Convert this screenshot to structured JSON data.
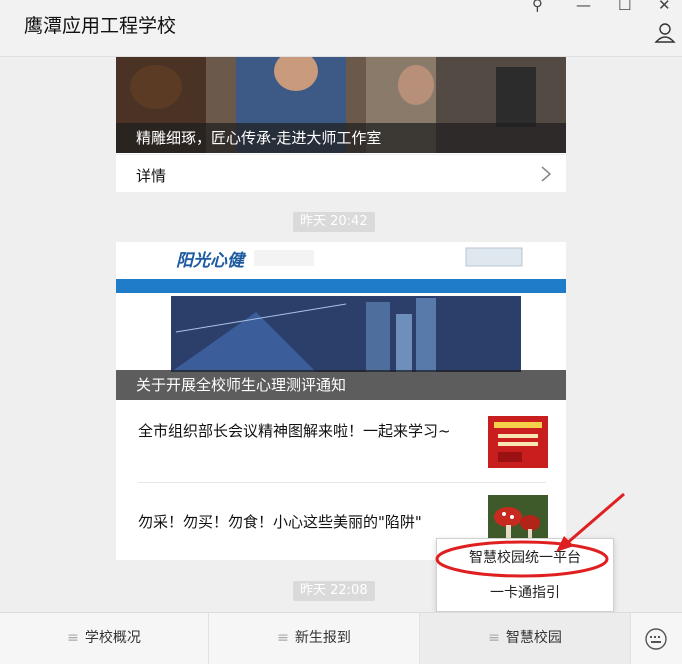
{
  "window": {
    "title": "鹰潭应用工程学校",
    "pin_glyph": "⚲",
    "min_glyph": "—",
    "max_glyph": "☐",
    "close_glyph": "✕"
  },
  "card1": {
    "caption": "精雕细琢，匠心传承-走进大师工作室",
    "detail_label": "详情"
  },
  "time1": "昨天 20:42",
  "card2": {
    "caption": "关于开展全校师生心理测评通知",
    "banner_logo": "阳光心健",
    "articles": [
      {
        "title": "全市组织部长会议精神图解来啦！一起来学习~"
      },
      {
        "title": "勿采！勿买！勿食！小心这些美丽的\"陷阱\""
      }
    ]
  },
  "time2": "昨天 22:08",
  "popup": {
    "items": [
      "智慧校园统一平台",
      "一卡通指引"
    ]
  },
  "tabs": [
    "学校概况",
    "新生报到",
    "智慧校园"
  ],
  "tab_prefix": "≡",
  "colors": {
    "annotation_red": "#e02020",
    "caption_bg": "#1e1e1e"
  }
}
